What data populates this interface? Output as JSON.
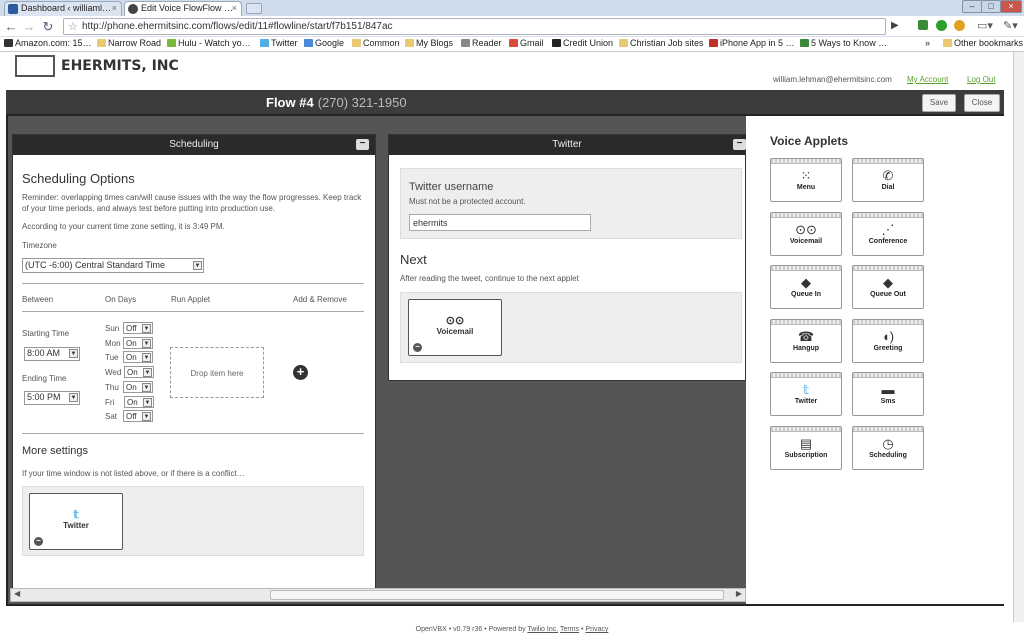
{
  "browser": {
    "tabs": [
      {
        "label": "Dashboard ‹ williaml…"
      },
      {
        "label": "Edit Voice FlowFlow …"
      }
    ],
    "url": "http://phone.ehermitsinc.com/flows/edit/11#flowline/start/f7b151/847ac",
    "bookmarks": [
      "Amazon.com: 15…",
      "Narrow Road",
      "Hulu - Watch yo…",
      "Twitter",
      "Google",
      "Common",
      "My Blogs",
      "Reader",
      "Gmail",
      "Credit Union",
      "Christian Job sites",
      "iPhone App in 5 …",
      "5 Ways to Know …"
    ],
    "other_bookmarks": "Other bookmarks",
    "more": "»"
  },
  "header": {
    "logo_text": "EHERMITS, INC",
    "user_email": "william.lehman@ehermitsinc.com",
    "my_account": "My Account",
    "log_out": "Log Out"
  },
  "flow": {
    "title": "Flow #4",
    "phone": "(270) 321-1950",
    "save": "Save",
    "close": "Close"
  },
  "scheduling": {
    "header": "Scheduling",
    "heading": "Scheduling Options",
    "reminder": "Reminder: overlapping times can/will cause issues with the way the flow progresses. Keep track of your time periods, and always test before putting into production use.",
    "current_time": "According to your current time zone setting, it is 3:49 PM.",
    "timezone_label": "Timezone",
    "timezone_value": "(UTC -6:00) Central Standard Time",
    "col_between": "Between",
    "col_on_days": "On Days",
    "col_run_applet": "Run Applet",
    "col_add_remove": "Add & Remove",
    "starting_time_label": "Starting Time",
    "starting_time": "8:00 AM",
    "ending_time_label": "Ending Time",
    "ending_time": "5:00 PM",
    "days": [
      {
        "day": "Sun",
        "value": "Off"
      },
      {
        "day": "Mon",
        "value": "On"
      },
      {
        "day": "Tue",
        "value": "On"
      },
      {
        "day": "Wed",
        "value": "On"
      },
      {
        "day": "Thu",
        "value": "On"
      },
      {
        "day": "Fri",
        "value": "On"
      },
      {
        "day": "Sat",
        "value": "Off"
      }
    ],
    "drop_text": "Drop item here",
    "more_settings": "More settings",
    "more_desc": "If your time window is not listed above, or if there is a conflict…",
    "fallback_applet": "Twitter"
  },
  "twitter": {
    "header": "Twitter",
    "username_label": "Twitter username",
    "username_hint": "Must not be a protected account.",
    "username_value": "ehermits",
    "next_heading": "Next",
    "next_desc": "After reading the tweet, continue to the next applet",
    "next_applet": "Voicemail"
  },
  "applets": {
    "title": "Voice Applets",
    "items": [
      {
        "label": "Menu",
        "icon": "grid-icon"
      },
      {
        "label": "Dial",
        "icon": "phone-icon"
      },
      {
        "label": "Voicemail",
        "icon": "voicemail-icon"
      },
      {
        "label": "Conference",
        "icon": "conference-icon"
      },
      {
        "label": "Queue In",
        "icon": "box-icon"
      },
      {
        "label": "Queue Out",
        "icon": "box-icon"
      },
      {
        "label": "Hangup",
        "icon": "hangup-icon"
      },
      {
        "label": "Greeting",
        "icon": "speaker-icon"
      },
      {
        "label": "Twitter",
        "icon": "twitter-icon"
      },
      {
        "label": "Sms",
        "icon": "sms-icon"
      },
      {
        "label": "Subscription",
        "icon": "document-icon"
      },
      {
        "label": "Scheduling",
        "icon": "clock-icon"
      }
    ]
  },
  "footer": {
    "text": "OpenVBX • v0.79 r36 • Powered by",
    "twilio": "Twilio Inc.",
    "sep": "•",
    "terms": "Terms",
    "privacy": "Privacy"
  },
  "colors": {
    "accent_green": "#5a9e2a",
    "dark_bar": "#3c3c3c",
    "twitter_blue": "#4fb0e8"
  }
}
